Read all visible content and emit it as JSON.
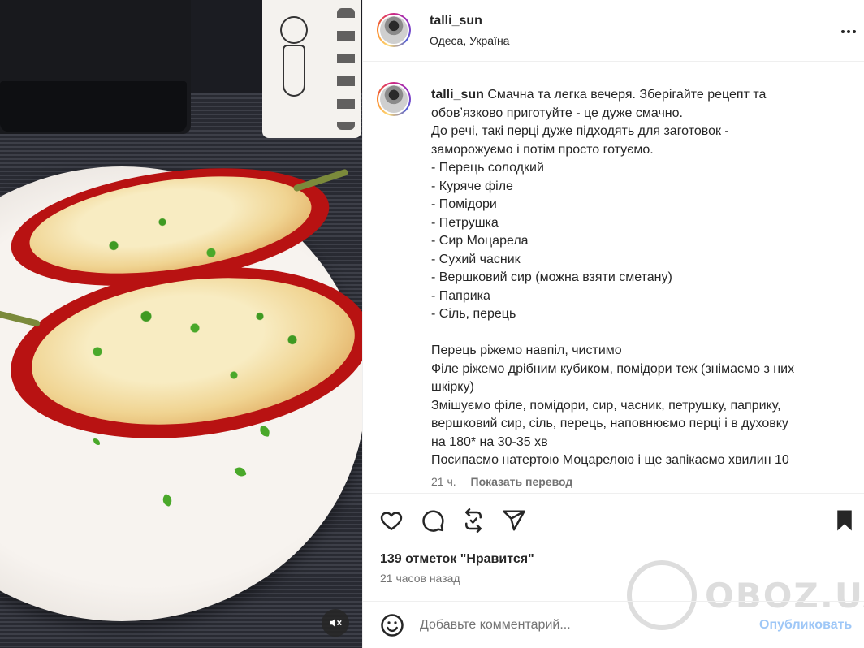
{
  "post": {
    "username": "talli_sun",
    "location": "Одеса, Україна"
  },
  "caption": {
    "username": "talli_sun",
    "lines": [
      "Смачна та легка вечеря. Зберігайте рецепт та",
      "обовʼязково приготуйте - це дуже смачно.",
      "До речі, такі перці дуже підходять для заготовок -",
      "заморожуємо і потім просто готуємо.",
      "- Перець солодкий",
      "- Куряче філе",
      "- Помідори",
      "- Петрушка",
      "- Сир Моцарела",
      "- Сухий часник",
      "- Вершковий сир (можна взяти сметану)",
      "- Паприка",
      "- Сіль, перець",
      "",
      "Перець ріжемо навпіл, чистимо",
      "Філе ріжемо дрібним кубиком, помідори теж (знімаємо з них",
      "шкірку)",
      "Змішуємо філе, помідори, сир, часник, петрушку, паприку,",
      "вершковий сир, сіль, перець, наповнюємо перці і в духовку",
      "на 180* на 30-35 хв",
      "Посипаємо натертою Моцарелою і ще запікаємо хвилин 10"
    ],
    "age": "21 ч.",
    "translate_label": "Показать перевод"
  },
  "stats": {
    "likes": "139 отметок \"Нравится\"",
    "time_ago": "21 часов назад"
  },
  "comment": {
    "placeholder": "Добавьте комментарий...",
    "publish_label": "Опубликовать"
  },
  "watermark": {
    "text": "OBOZ.UA"
  },
  "colors": {
    "publish": "#9ec7f7",
    "text": "#262626",
    "secondary": "#737373"
  },
  "icons": {
    "like": "heart-icon",
    "comment": "comment-icon",
    "repost": "repost-icon",
    "share": "share-icon",
    "save": "bookmark-icon",
    "emoji": "emoji-icon",
    "mute": "muted-speaker-icon",
    "more": "more-dots-icon"
  }
}
